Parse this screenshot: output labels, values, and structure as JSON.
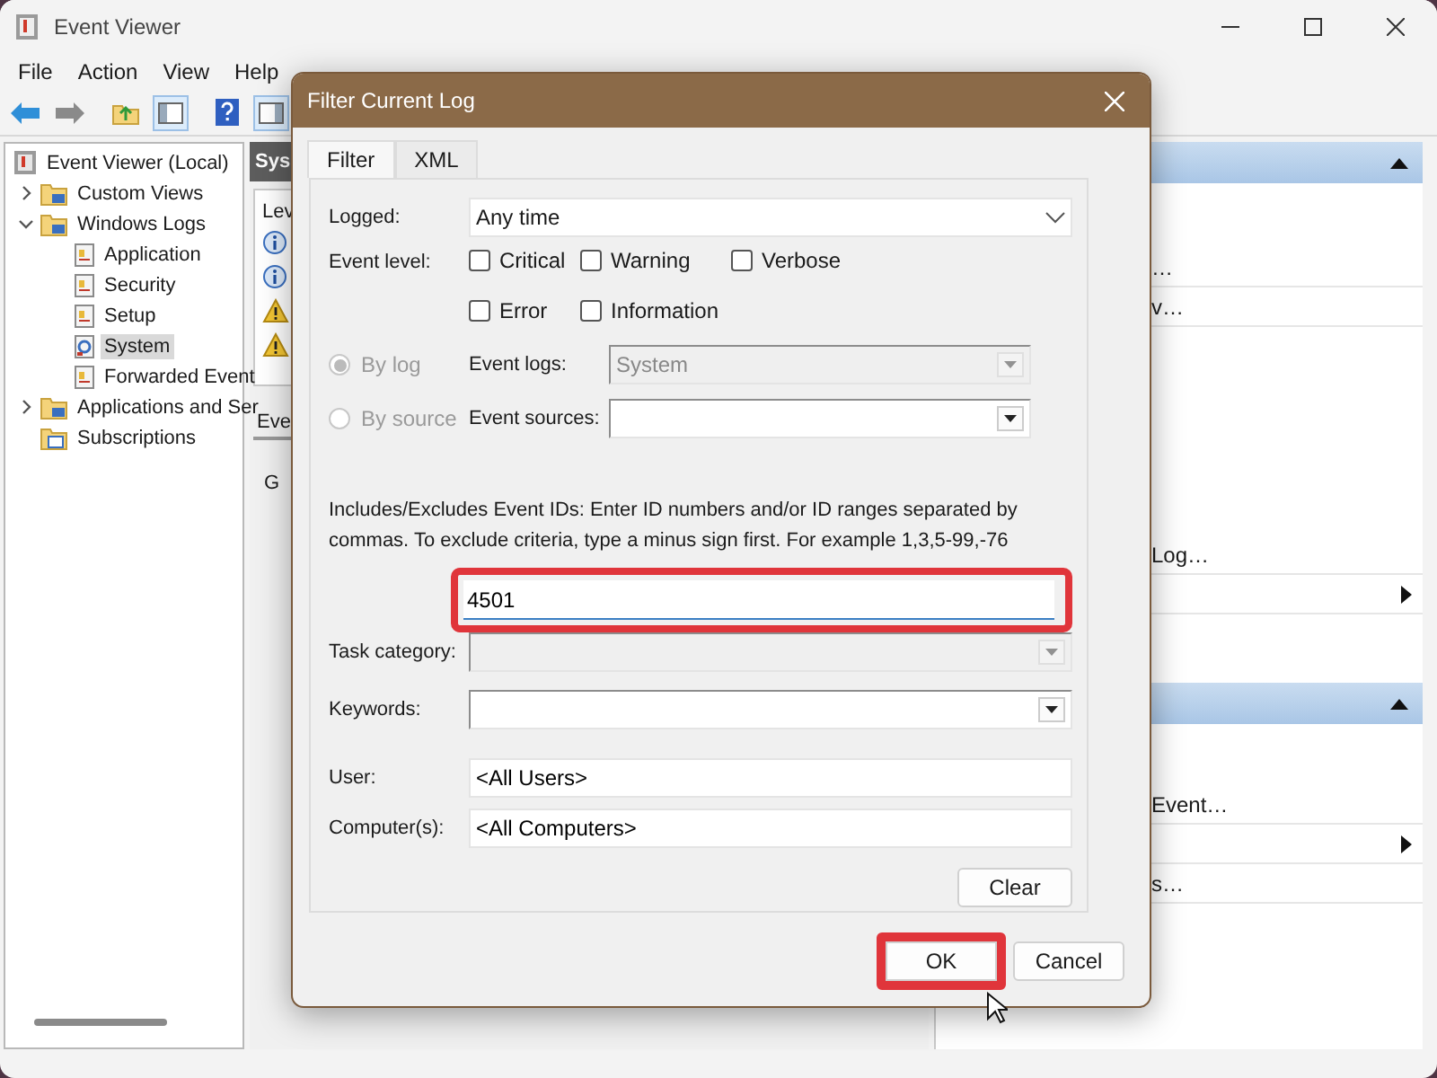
{
  "window": {
    "title": "Event Viewer"
  },
  "menu": [
    "File",
    "Action",
    "View",
    "Help"
  ],
  "tree": [
    {
      "label": "Event Viewer (Local)",
      "kind": "root",
      "selected": false,
      "children": [
        {
          "label": "Custom Views",
          "kind": "folder",
          "expanded": false,
          "selected": false
        },
        {
          "label": "Windows Logs",
          "kind": "folder",
          "expanded": true,
          "selected": false,
          "children": [
            {
              "label": "Application",
              "kind": "log",
              "selected": false
            },
            {
              "label": "Security",
              "kind": "log",
              "selected": false
            },
            {
              "label": "Setup",
              "kind": "log",
              "selected": false
            },
            {
              "label": "System",
              "kind": "system",
              "selected": true
            },
            {
              "label": "Forwarded Event",
              "kind": "log",
              "selected": false
            }
          ]
        },
        {
          "label": "Applications and Ser",
          "kind": "folder",
          "expanded": false,
          "selected": false
        },
        {
          "label": "Subscriptions",
          "kind": "subs",
          "selected": false
        }
      ]
    }
  ],
  "middle": {
    "header": "Sys",
    "column": "Lev",
    "rows": [
      {
        "kind": "info"
      },
      {
        "kind": "info"
      },
      {
        "kind": "warning"
      },
      {
        "kind": "warning"
      }
    ],
    "tab": "Eve",
    "group": "G"
  },
  "actions": {
    "sections": [
      {
        "items": [
          {
            "kind": "text",
            "label": "…"
          },
          {
            "kind": "text",
            "label": "v…"
          },
          {
            "kind": "text",
            "label": "Log…"
          },
          {
            "kind": "submenu"
          }
        ]
      },
      {
        "items": [
          {
            "kind": "text",
            "label": "Event…"
          },
          {
            "kind": "submenu"
          },
          {
            "kind": "text",
            "label": "s…"
          }
        ]
      }
    ]
  },
  "dialog": {
    "title": "Filter Current Log",
    "tabs": [
      {
        "label": "Filter",
        "selected": true
      },
      {
        "label": "XML",
        "selected": false
      }
    ],
    "logged": {
      "label": "Logged:",
      "value": "Any time"
    },
    "event_level": {
      "label": "Event level:",
      "options": [
        {
          "label": "Critical",
          "checked": false
        },
        {
          "label": "Warning",
          "checked": false
        },
        {
          "label": "Verbose",
          "checked": false
        },
        {
          "label": "Error",
          "checked": false
        },
        {
          "label": "Information",
          "checked": false
        }
      ]
    },
    "source_mode": [
      {
        "label": "By log",
        "selected": true,
        "disabled": true,
        "field_label": "Event logs:",
        "value": "System"
      },
      {
        "label": "By source",
        "selected": false,
        "disabled": true,
        "field_label": "Event sources:"
      }
    ],
    "description": "Includes/Excludes Event IDs: Enter ID numbers and/or ID ranges separated by commas. To exclude criteria, type a minus sign first. For example 1,3,5-99,-76",
    "event_ids": {
      "value": "4501",
      "highlighted": true
    },
    "task_category": {
      "label": "Task category:",
      "disabled": true
    },
    "keywords": {
      "label": "Keywords:",
      "disabled": false
    },
    "user": {
      "label": "User:",
      "value": "<All Users>"
    },
    "computer": {
      "label": "Computer(s):",
      "value": "<All Computers>"
    },
    "clear_button": "Clear",
    "buttons": [
      {
        "label": "OK",
        "highlighted": true
      },
      {
        "label": "Cancel",
        "highlighted": false
      }
    ]
  }
}
